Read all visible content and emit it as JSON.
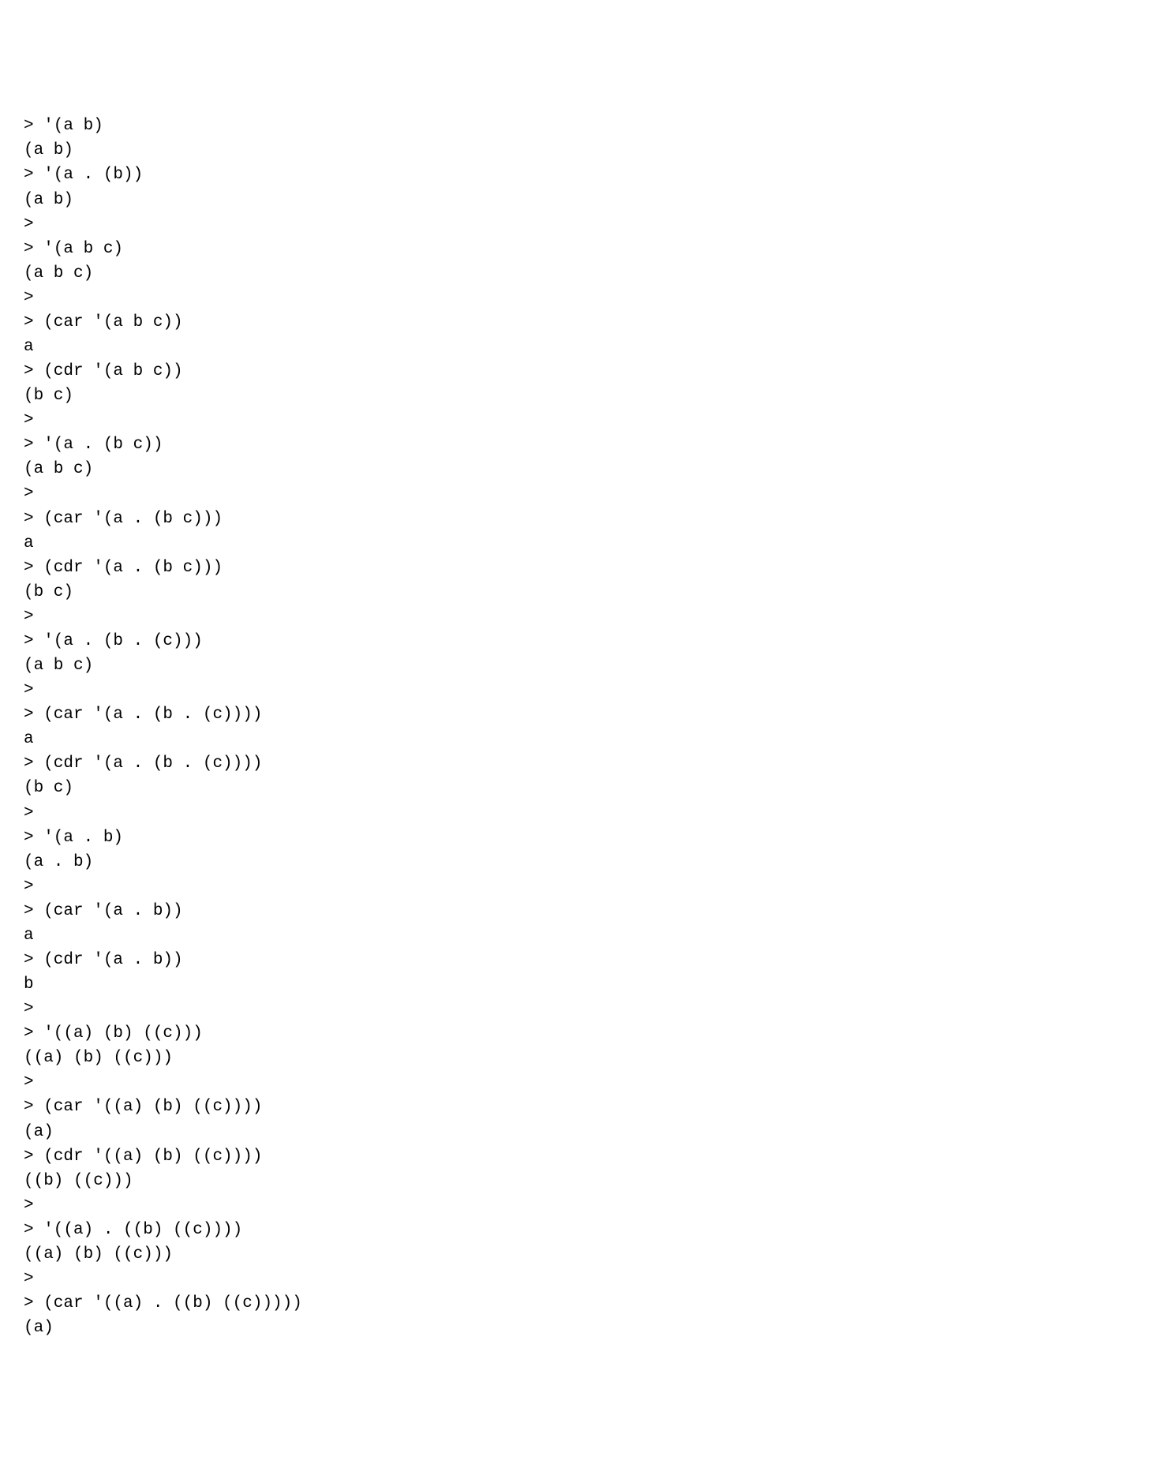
{
  "lines": [
    "> '(a b)",
    "(a b)",
    "> '(a . (b))",
    "(a b)",
    ">",
    "> '(a b c)",
    "(a b c)",
    ">",
    "> (car '(a b c))",
    "a",
    "> (cdr '(a b c))",
    "(b c)",
    ">",
    "> '(a . (b c))",
    "(a b c)",
    ">",
    "> (car '(a . (b c)))",
    "a",
    "> (cdr '(a . (b c)))",
    "(b c)",
    ">",
    "> '(a . (b . (c)))",
    "(a b c)",
    ">",
    "> (car '(a . (b . (c))))",
    "a",
    "> (cdr '(a . (b . (c))))",
    "(b c)",
    ">",
    "> '(a . b)",
    "(a . b)",
    ">",
    "> (car '(a . b))",
    "a",
    "> (cdr '(a . b))",
    "b",
    ">",
    "> '((a) (b) ((c)))",
    "((a) (b) ((c)))",
    ">",
    "> (car '((a) (b) ((c))))",
    "(a)",
    "> (cdr '((a) (b) ((c))))",
    "((b) ((c)))",
    ">",
    "> '((a) . ((b) ((c))))",
    "((a) (b) ((c)))",
    ">",
    "> (car '((a) . ((b) ((c)))))",
    "(a)"
  ]
}
